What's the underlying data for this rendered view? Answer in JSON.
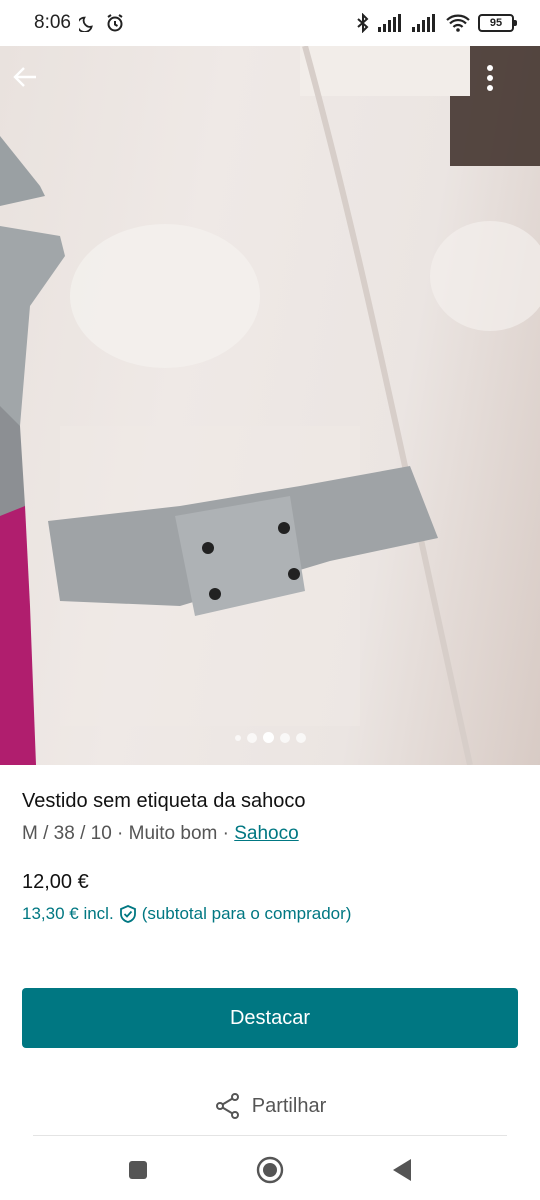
{
  "status_bar": {
    "time": "8:06",
    "battery": "95",
    "icons": [
      "moon-icon",
      "alarm-icon",
      "bluetooth-icon",
      "signal-icon",
      "signal-icon-2",
      "wifi-icon",
      "battery-icon"
    ]
  },
  "photo": {
    "dots_total": 5,
    "active_dot": 2
  },
  "listing": {
    "title": "Vestido  sem etiqueta da sahoco",
    "meta_prefix": "M / 38 / 10 · Muito bom · ",
    "brand": "Sahoco",
    "price": "12,00 €",
    "price_incl": "13,30 € incl.",
    "price_note": "(subtotal para o comprador)"
  },
  "actions": {
    "highlight": "Destacar",
    "share": "Partilhar"
  },
  "colors": {
    "accent": "#007782"
  }
}
